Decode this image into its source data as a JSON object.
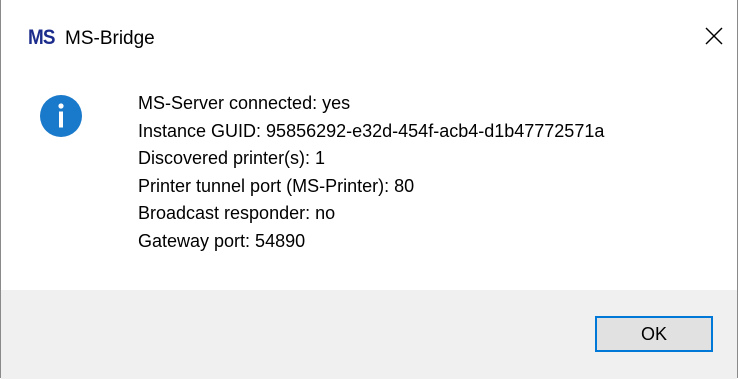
{
  "window": {
    "logo_text": "MS",
    "title": "MS-Bridge",
    "close_icon": "close-icon"
  },
  "message": {
    "icon": "info-icon",
    "icon_color": "#1979ca",
    "lines": [
      "MS-Server connected: yes",
      "Instance GUID: 95856292-e32d-454f-acb4-d1b47772571a",
      "Discovered printer(s): 1",
      "Printer tunnel port (MS-Printer): 80",
      "Broadcast responder: no",
      "Gateway port: 54890"
    ]
  },
  "buttons": {
    "ok_label": "OK"
  },
  "colors": {
    "accent": "#0078d7",
    "footer_bg": "#f0f0f0",
    "logo": "#1c2c8c"
  }
}
